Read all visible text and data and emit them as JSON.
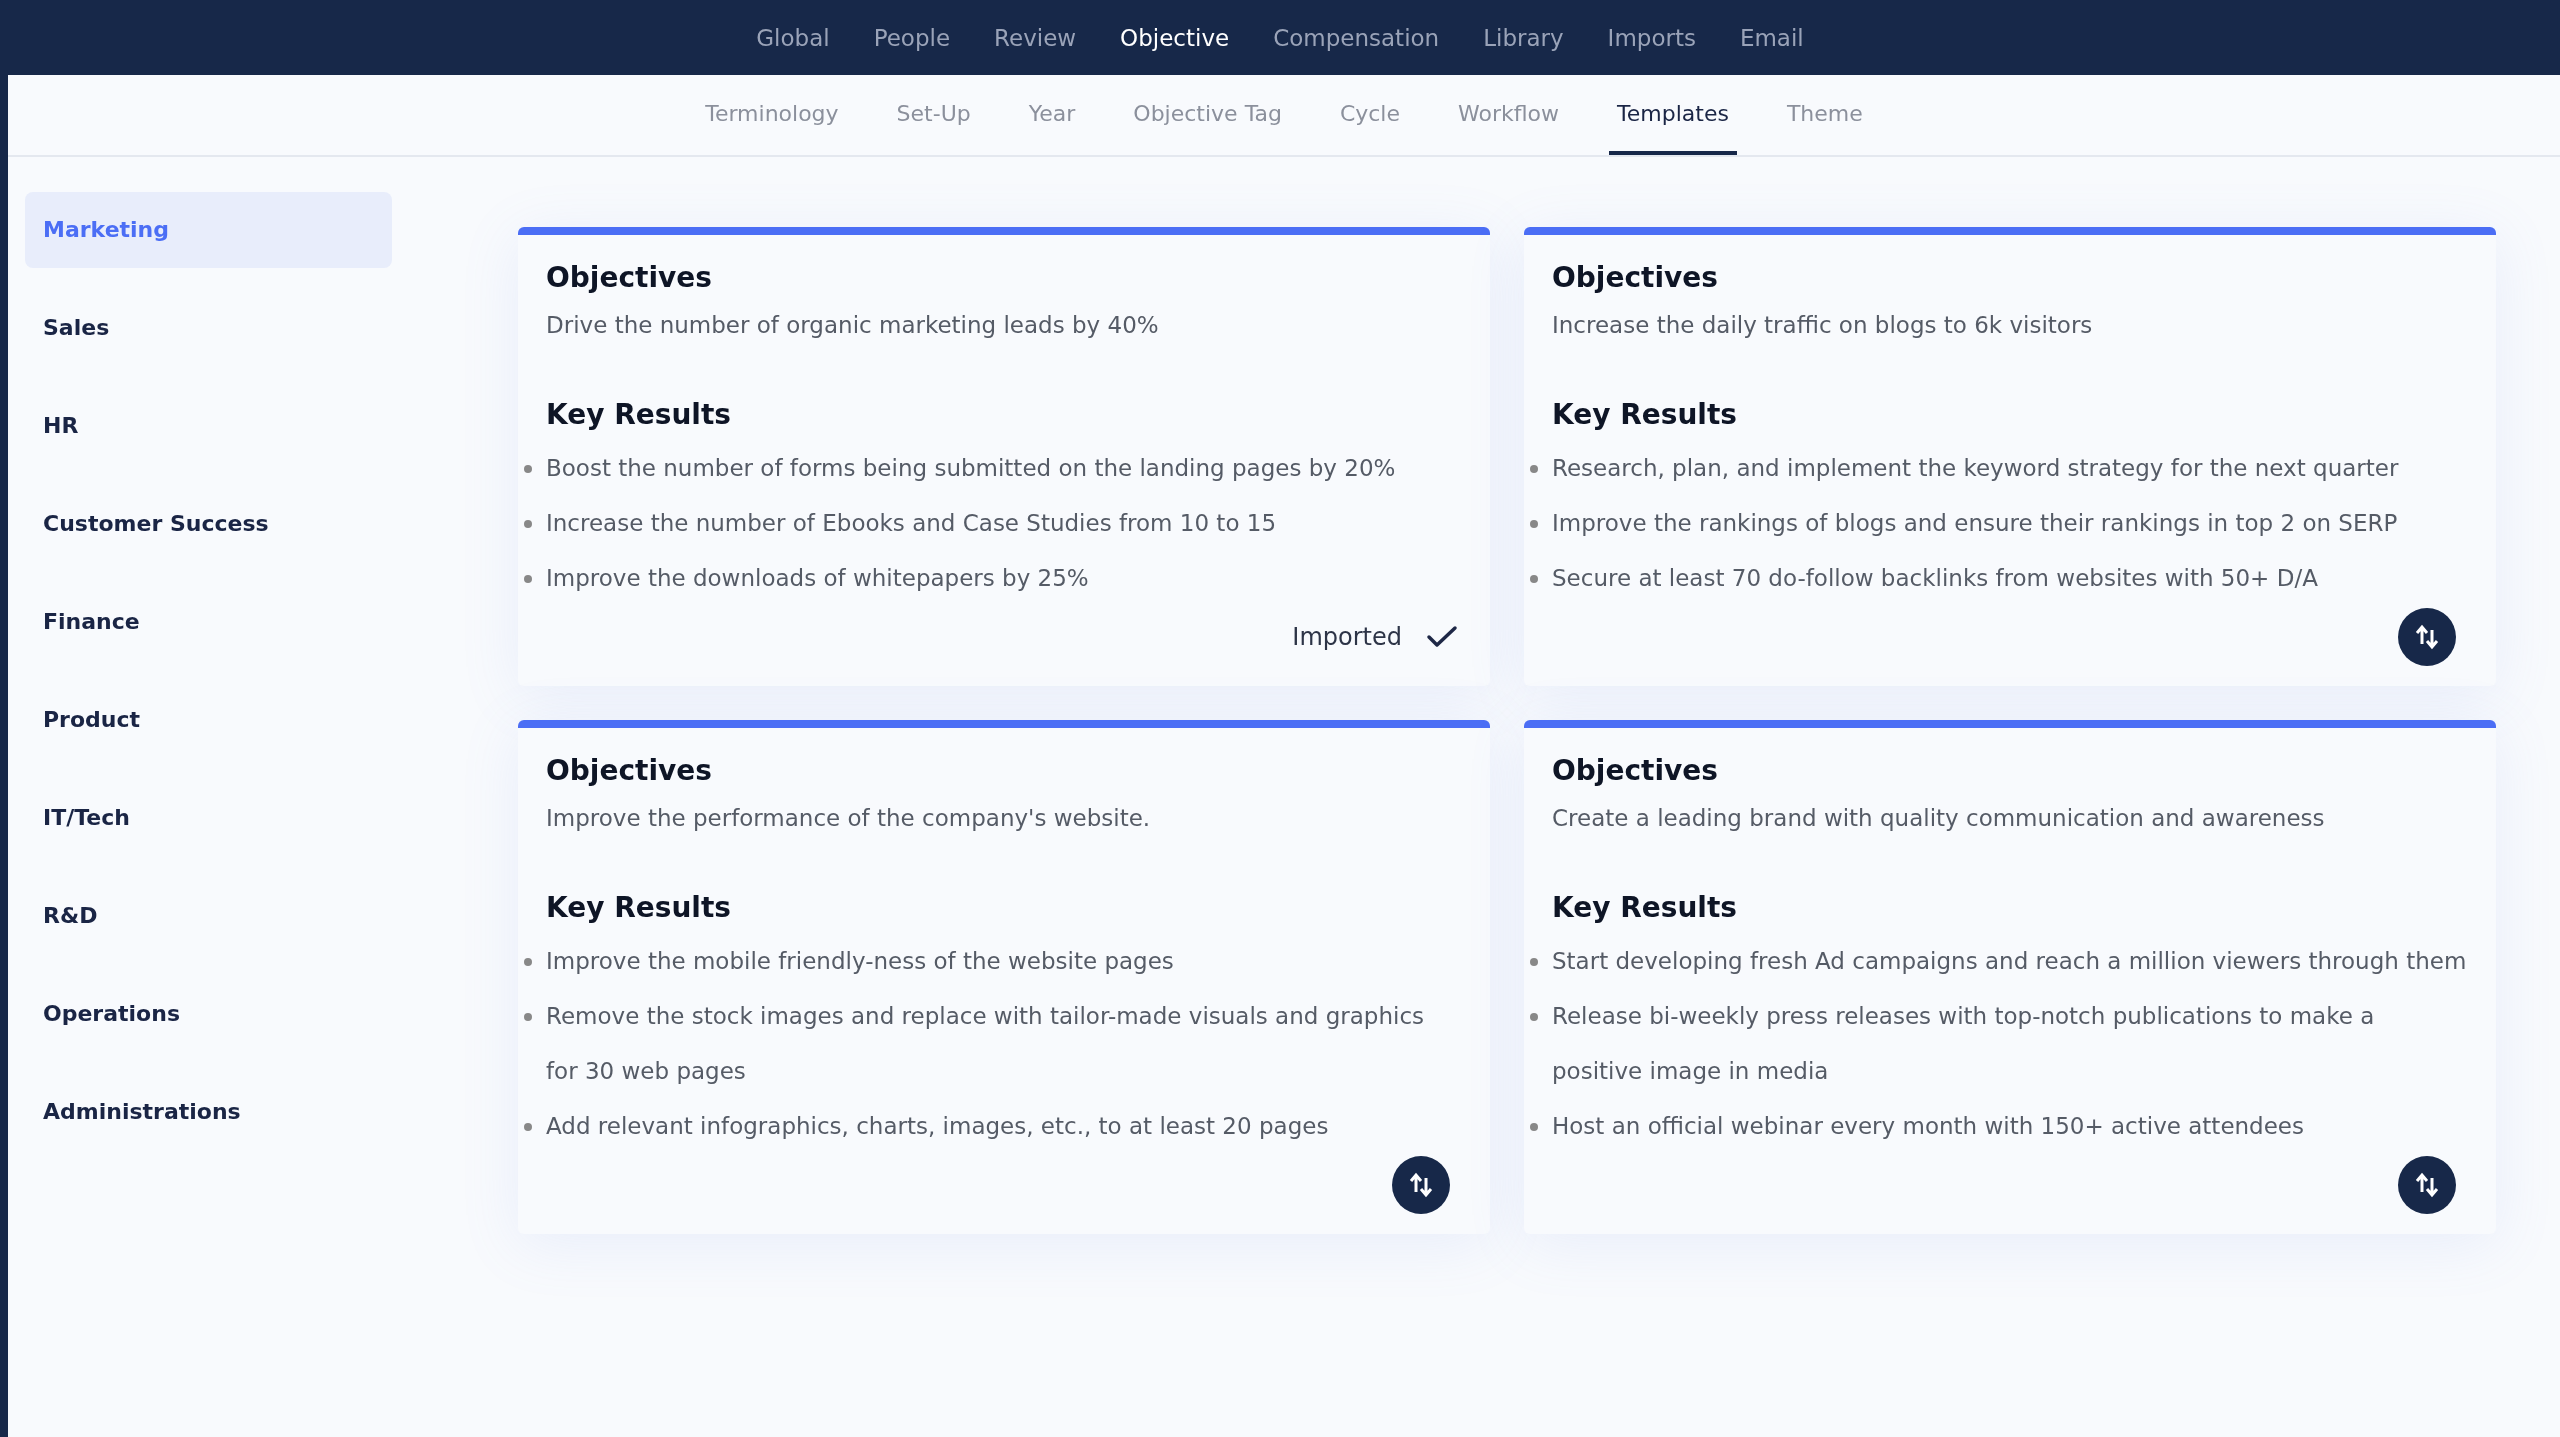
{
  "top_nav": [
    {
      "label": "Global",
      "selected": false
    },
    {
      "label": "People",
      "selected": false
    },
    {
      "label": "Review",
      "selected": false
    },
    {
      "label": "Objective",
      "selected": true
    },
    {
      "label": "Compensation",
      "selected": false
    },
    {
      "label": "Library",
      "selected": false
    },
    {
      "label": "Imports",
      "selected": false
    },
    {
      "label": "Email",
      "selected": false
    }
  ],
  "sub_tabs": [
    {
      "label": "Terminology",
      "selected": false
    },
    {
      "label": "Set-Up",
      "selected": false
    },
    {
      "label": "Year",
      "selected": false
    },
    {
      "label": "Objective Tag",
      "selected": false
    },
    {
      "label": "Cycle",
      "selected": false
    },
    {
      "label": "Workflow",
      "selected": false
    },
    {
      "label": "Templates",
      "selected": true
    },
    {
      "label": "Theme",
      "selected": false
    }
  ],
  "sidebar": {
    "items": [
      {
        "label": "Marketing",
        "selected": true
      },
      {
        "label": "Sales",
        "selected": false
      },
      {
        "label": "HR",
        "selected": false
      },
      {
        "label": "Customer Success",
        "selected": false
      },
      {
        "label": "Finance",
        "selected": false
      },
      {
        "label": "Product",
        "selected": false
      },
      {
        "label": "IT/Tech",
        "selected": false
      },
      {
        "label": "R&D",
        "selected": false
      },
      {
        "label": "Operations",
        "selected": false
      },
      {
        "label": "Administrations",
        "selected": false
      }
    ]
  },
  "templates": [
    {
      "objectives_heading": "Objectives",
      "objective": "Drive the number of organic marketing leads by 40%",
      "key_results_heading": "Key Results",
      "key_results": [
        "Boost the number of forms being submitted on the landing pages by 20%",
        "Increase the number of Ebooks and Case Studies from 10 to 15",
        "Improve the downloads of whitepapers by 25%"
      ],
      "status": {
        "kind": "imported",
        "label": "Imported"
      }
    },
    {
      "objectives_heading": "Objectives",
      "objective": "Increase the daily traffic on blogs to 6k visitors",
      "key_results_heading": "Key Results",
      "key_results": [
        "Research, plan, and implement the keyword strategy for the next quarter",
        "Improve the rankings of blogs and ensure their rankings in top 2 on SERP",
        "Secure at least 70 do-follow backlinks from websites with 50+ D/A"
      ],
      "status": {
        "kind": "import"
      }
    },
    {
      "objectives_heading": "Objectives",
      "objective": "Improve the performance of the company's website.",
      "key_results_heading": "Key Results",
      "key_results": [
        "Improve the mobile friendly-ness of the website pages",
        "Remove the stock images and replace with tailor-made visuals and graphics for 30 web pages",
        "Add relevant infographics, charts, images, etc., to at least 20 pages"
      ],
      "status": {
        "kind": "import"
      }
    },
    {
      "objectives_heading": "Objectives",
      "objective": "Create a leading brand with quality communication and awareness",
      "key_results_heading": "Key Results",
      "key_results": [
        "Start developing fresh Ad campaigns and reach a million viewers through them",
        "Release bi-weekly press releases with top-notch publications to make a positive image in media",
        "Host an official webinar every month with 150+ active attendees"
      ],
      "status": {
        "kind": "import"
      }
    }
  ]
}
